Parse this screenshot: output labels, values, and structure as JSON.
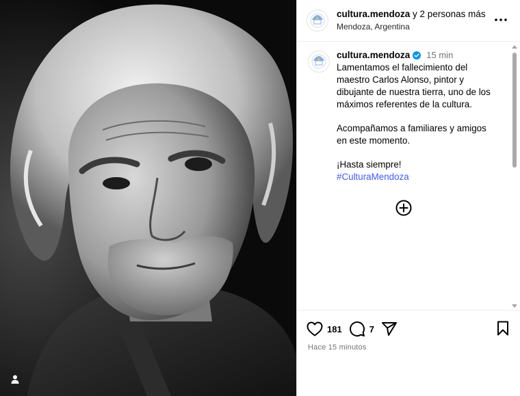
{
  "header": {
    "username": "cultura.mendoza",
    "collab_text": "y 2 personas más",
    "location": "Mendoza, Argentina",
    "more_icon": "more-options-icon"
  },
  "caption": {
    "username": "cultura.mendoza",
    "time": "15 min",
    "verified_icon": "verified-badge-icon",
    "paragraph1": "Lamentamos el fallecimiento del maestro Carlos Alonso, pintor y dibujante de nuestra tierra, uno de los máximos referentes de la cultura.",
    "paragraph2": "Acompañamos a familiares y amigos en este momento.",
    "paragraph3": "¡Hasta siempre!",
    "hashtag": "#CulturaMendoza"
  },
  "actions": {
    "likes": "181",
    "comments": "7",
    "like_icon": "heart-icon",
    "comment_icon": "comment-icon",
    "share_icon": "share-icon",
    "save_icon": "bookmark-icon"
  },
  "timestamp": "Hace 15 minutos",
  "colors": {
    "hashtag": "#3d5afe",
    "verified": "#0095f6",
    "muted": "#737373"
  }
}
